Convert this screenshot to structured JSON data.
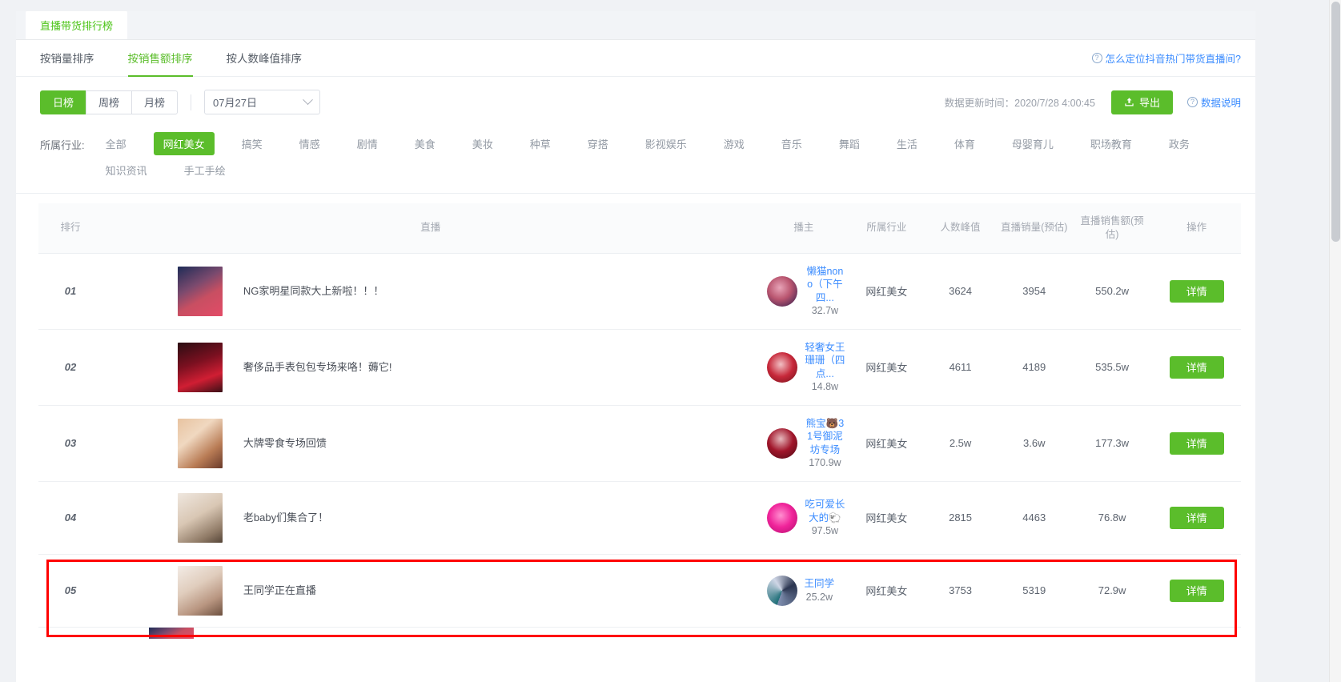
{
  "window": {
    "tab_label": "直播带货排行榜"
  },
  "sort_tabs": [
    {
      "label": "按销量排序",
      "active": false
    },
    {
      "label": "按销售额排序",
      "active": true
    },
    {
      "label": "按人数峰值排序",
      "active": false
    }
  ],
  "help_link": {
    "icon": "question-circle-icon",
    "label": "怎么定位抖音热门带货直播间?"
  },
  "toolbar": {
    "period_buttons": [
      {
        "label": "日榜",
        "active": true
      },
      {
        "label": "周榜",
        "active": false
      },
      {
        "label": "月榜",
        "active": false
      }
    ],
    "date_value": "07月27日",
    "date_icon": "chevron-down-icon",
    "updated_label": "数据更新时间：2020/7/28 4:00:45",
    "export_label": "导出",
    "export_icon": "upload-icon",
    "datanote_label": "数据说明",
    "datanote_icon": "question-circle-icon"
  },
  "industry": {
    "label": "所属行业:",
    "items": [
      {
        "label": "全部",
        "active": false
      },
      {
        "label": "网红美女",
        "active": true
      },
      {
        "label": "搞笑",
        "active": false
      },
      {
        "label": "情感",
        "active": false
      },
      {
        "label": "剧情",
        "active": false
      },
      {
        "label": "美食",
        "active": false
      },
      {
        "label": "美妆",
        "active": false
      },
      {
        "label": "种草",
        "active": false
      },
      {
        "label": "穿搭",
        "active": false
      },
      {
        "label": "影视娱乐",
        "active": false
      },
      {
        "label": "游戏",
        "active": false
      },
      {
        "label": "音乐",
        "active": false
      },
      {
        "label": "舞蹈",
        "active": false
      },
      {
        "label": "生活",
        "active": false
      },
      {
        "label": "体育",
        "active": false
      },
      {
        "label": "母婴育儿",
        "active": false
      },
      {
        "label": "职场教育",
        "active": false
      },
      {
        "label": "政务",
        "active": false
      },
      {
        "label": "知识资讯",
        "active": false
      },
      {
        "label": "手工手绘",
        "active": false
      }
    ]
  },
  "table": {
    "headers": {
      "rank": "排行",
      "live": "直播",
      "host": "播主",
      "industry": "所属行业",
      "peak": "人数峰值",
      "volume": "直播销量(预估)",
      "amount": "直播销售额(预估)",
      "operation": "操作"
    },
    "action_label": "详情",
    "rows": [
      {
        "rank": "01",
        "live_title": "NG家明星同款大上新啦！！！",
        "host_name": "懒猫nono（下午四...",
        "host_fans": "32.7w",
        "industry": "网红美女",
        "peak": "3624",
        "volume": "3954",
        "amount": "550.2w",
        "action": "详情",
        "highlighted": false
      },
      {
        "rank": "02",
        "live_title": "奢侈品手表包包专场来咯！薅它!",
        "host_name": "轻奢女王珊珊（四点...",
        "host_fans": "14.8w",
        "industry": "网红美女",
        "peak": "4611",
        "volume": "4189",
        "amount": "535.5w",
        "action": "详情",
        "highlighted": false
      },
      {
        "rank": "03",
        "live_title": "大牌零食专场回馈",
        "host_name": "熊宝🐻31号御泥坊专场",
        "host_fans": "170.9w",
        "industry": "网红美女",
        "peak": "2.5w",
        "volume": "3.6w",
        "amount": "177.3w",
        "action": "详情",
        "highlighted": false
      },
      {
        "rank": "04",
        "live_title": "老baby们集合了！",
        "host_name": "吃可爱长大的🐑",
        "host_fans": "97.5w",
        "industry": "网红美女",
        "peak": "2815",
        "volume": "4463",
        "amount": "76.8w",
        "action": "详情",
        "highlighted": false
      },
      {
        "rank": "05",
        "live_title": "王同学正在直播",
        "host_name": "王同学",
        "host_fans": "25.2w",
        "industry": "网红美女",
        "peak": "3753",
        "volume": "5319",
        "amount": "72.9w",
        "action": "详情",
        "highlighted": true
      }
    ]
  },
  "colors": {
    "brand_green": "#5bbd2b",
    "link_blue": "#3b8cff",
    "highlight_red": "#ff0000"
  }
}
